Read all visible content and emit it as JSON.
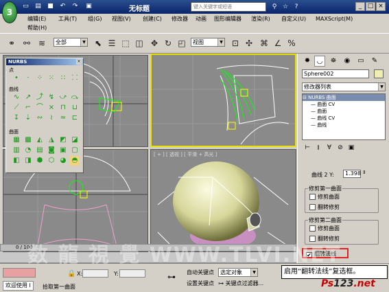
{
  "app": {
    "title": "无标题",
    "search_placeholder": "键入关键字或短语"
  },
  "menu": [
    {
      "label": "编辑(E)"
    },
    {
      "label": "工具(T)"
    },
    {
      "label": "组(G)"
    },
    {
      "label": "视图(V)"
    },
    {
      "label": "创建(C)"
    },
    {
      "label": "修改器"
    },
    {
      "label": "动画"
    },
    {
      "label": "图形编辑器"
    },
    {
      "label": "渲染(R)"
    },
    {
      "label": "自定义(U)"
    },
    {
      "label": "MAXScript(M)"
    },
    {
      "label": "帮助(H)"
    }
  ],
  "toolbar": {
    "selection_filter": "全部",
    "ref_coord": "视图"
  },
  "nurbs_panel": {
    "title": "NURBS",
    "sections": [
      "点",
      "曲线",
      "曲面"
    ]
  },
  "viewports": [
    {
      "label": ""
    },
    {
      "label": ""
    },
    {
      "label": ""
    },
    {
      "label": "[ + ] [ 透视 ] [ 平滑 + 高光 ]"
    }
  ],
  "command_panel": {
    "object_name": "Sphere002",
    "modifier_list": "修改器列表",
    "stack": [
      "NURBS 曲面",
      "曲面 CV",
      "曲面",
      "曲线 CV",
      "曲线"
    ],
    "spin_label": "曲线 2 Y:",
    "spin_value": "1.398",
    "group1": {
      "title": "修剪第一曲面",
      "trim": "修剪曲面",
      "flip": "翻转修剪"
    },
    "group2": {
      "title": "修剪第二曲面",
      "trim": "修剪曲面",
      "flip": "翻转修剪"
    },
    "flip_normals": "翻转法线"
  },
  "timeline": {
    "frame": "0 / 100"
  },
  "status": {
    "welcome": "欢迎使用 I",
    "prompt": "拾取第一曲面",
    "x_label": "X:",
    "y_label": "Y:",
    "auto_key": "自动关键点",
    "set_key": "设置关键点",
    "selected": "选定对象",
    "key_filters": "关键点过滤器..."
  },
  "tip": "启用“翻转法线”复选框。",
  "brand": {
    "prefix": "Ps",
    "mid": "123",
    "suffix": ".net"
  },
  "watermark": "数 龍 視 覺   WWW.TLVI.NET"
}
